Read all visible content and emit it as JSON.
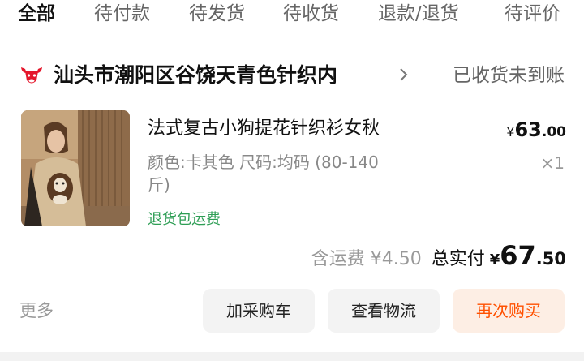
{
  "tabs": [
    {
      "label": "全部",
      "active": true
    },
    {
      "label": "待付款",
      "active": false
    },
    {
      "label": "待发货",
      "active": false
    },
    {
      "label": "待收货",
      "active": false
    },
    {
      "label": "退款/退货",
      "active": false
    },
    {
      "label": "待评价",
      "active": false
    }
  ],
  "shop": {
    "logo_icon": "bull-head-icon",
    "brand_color": "#e4162b",
    "name": "汕头市潮阳区谷饶天青色针织内",
    "chevron_icon": "chevron-right-icon"
  },
  "order": {
    "status": "已收货未到账"
  },
  "product": {
    "title": "法式复古小狗提花针织衫女秋",
    "price": {
      "currency": "¥",
      "integer": "63",
      "decimal": ".00"
    },
    "sku": "颜色:卡其色 尺码:均码 (80-140 斤)",
    "quantity": "×1",
    "return_tag": "退货包运费",
    "return_tag_color": "#2e9e55"
  },
  "summary": {
    "shipping": "含运费 ¥4.50",
    "total_label": "总实付",
    "total": {
      "currency": "¥",
      "integer": "67",
      "decimal": ".50"
    }
  },
  "actions": {
    "more": "更多",
    "add_to_cart": "加采购车",
    "view_logistics": "查看物流",
    "buy_again": "再次购买",
    "accent_color": "#ff5000"
  }
}
